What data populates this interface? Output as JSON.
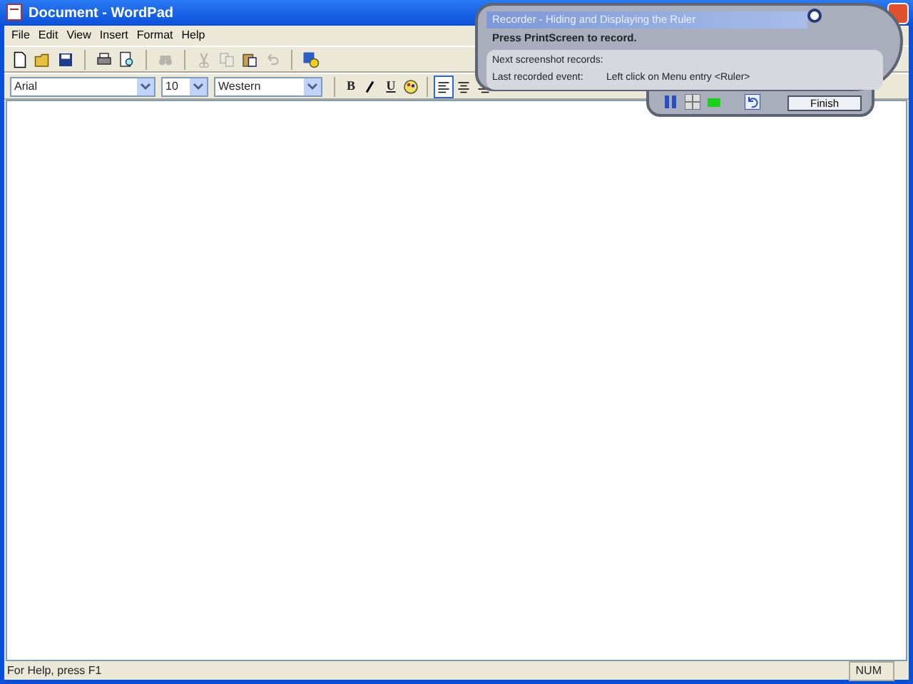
{
  "window": {
    "title": "Document - WordPad"
  },
  "menu": [
    {
      "label": "File"
    },
    {
      "label": "Edit"
    },
    {
      "label": "View"
    },
    {
      "label": "Insert"
    },
    {
      "label": "Format"
    },
    {
      "label": "Help"
    }
  ],
  "toolbar": [
    {
      "kind": "new",
      "disabled": false
    },
    {
      "kind": "open",
      "disabled": false
    },
    {
      "kind": "save",
      "disabled": false
    },
    {
      "kind": "sep"
    },
    {
      "kind": "print",
      "disabled": false
    },
    {
      "kind": "preview",
      "disabled": false
    },
    {
      "kind": "sep"
    },
    {
      "kind": "find",
      "disabled": true
    },
    {
      "kind": "sep"
    },
    {
      "kind": "cut",
      "disabled": true
    },
    {
      "kind": "copy",
      "disabled": true
    },
    {
      "kind": "paste",
      "disabled": false
    },
    {
      "kind": "undo",
      "disabled": true
    },
    {
      "kind": "sep"
    },
    {
      "kind": "datetime",
      "disabled": false
    }
  ],
  "format_bar": {
    "font": "Arial",
    "size": "10",
    "script": "Western",
    "buttons": [
      {
        "kind": "bold",
        "label": "B",
        "selected": false
      },
      {
        "kind": "italic",
        "selected": false
      },
      {
        "kind": "underline",
        "label": "U",
        "selected": false
      },
      {
        "kind": "color",
        "selected": false
      },
      {
        "kind": "align-left",
        "selected": true
      },
      {
        "kind": "align-center",
        "selected": false
      },
      {
        "kind": "align-right",
        "selected": false
      }
    ]
  },
  "status_bar": {
    "help": "For Help, press F1",
    "num": "NUM"
  },
  "recorder": {
    "title": "Recorder - Hiding and Displaying the Ruler",
    "instruction": "Press PrintScreen to record.",
    "next_label": "Next screenshot records:",
    "last_label": "Last recorded event:",
    "last_value": "Left click on Menu entry <Ruler>",
    "finish": "Finish"
  }
}
